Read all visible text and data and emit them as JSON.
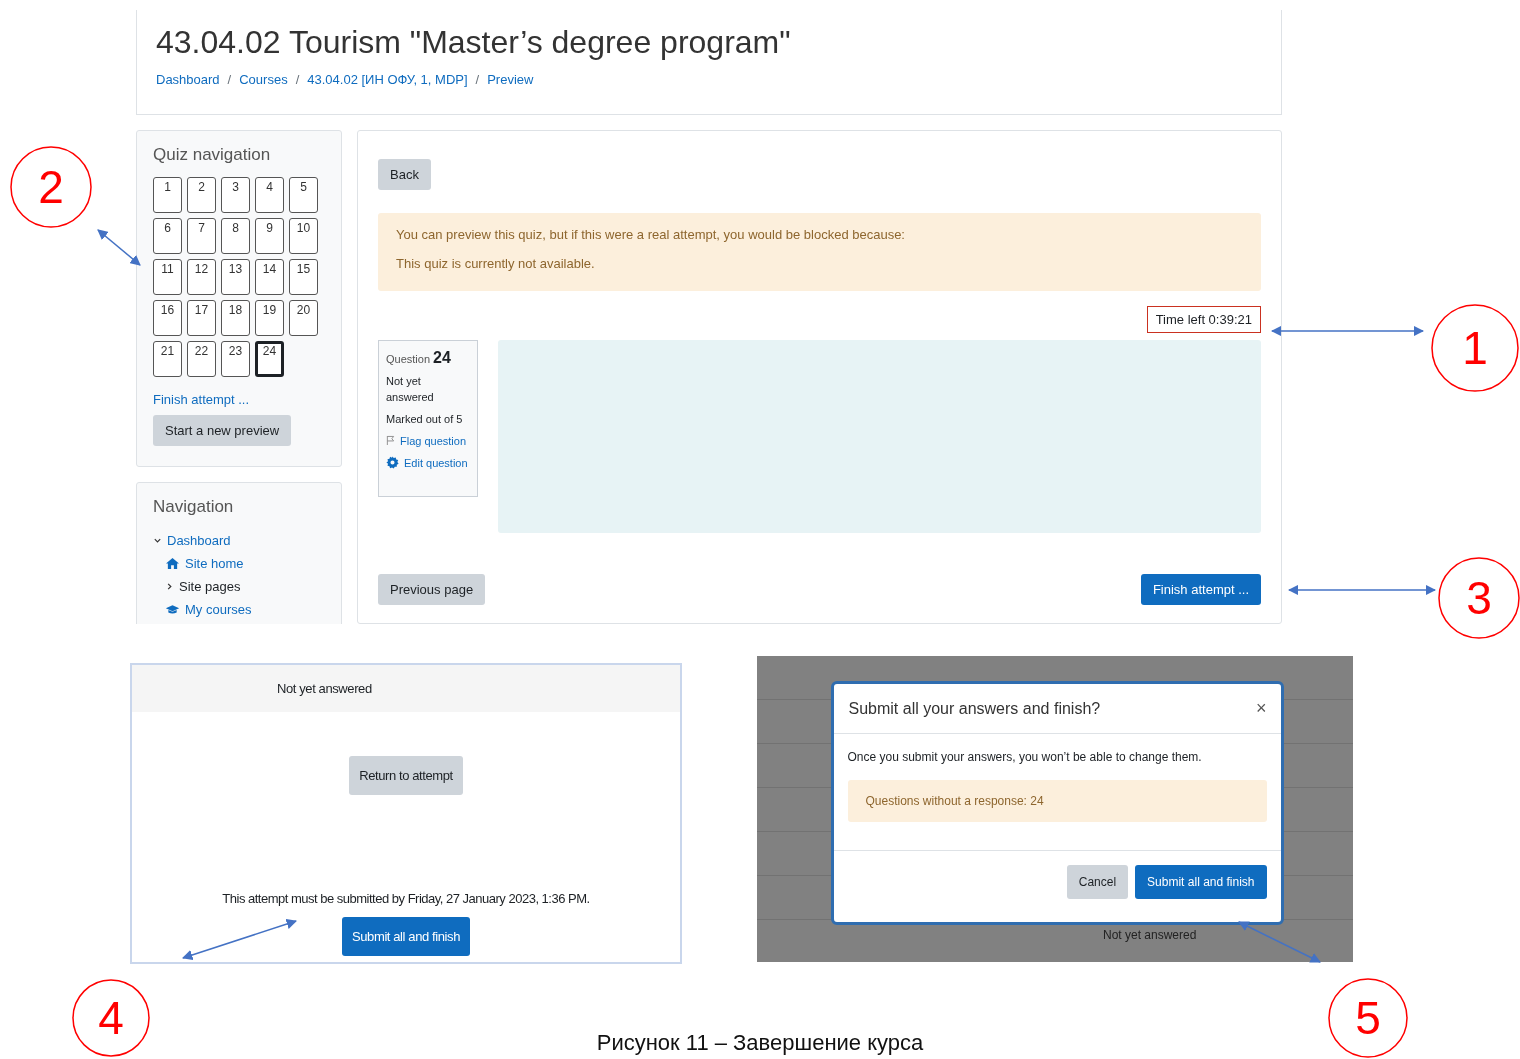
{
  "page_header": {
    "title": "43.04.02 Tourism \"Master’s degree program\"",
    "breadcrumb": [
      "Dashboard",
      "Courses",
      "43.04.02 [ИН ОФУ, 1, MDP]",
      "Preview"
    ],
    "separator": "/"
  },
  "quiz_navigation": {
    "title": "Quiz navigation",
    "questions": [
      {
        "label": "1",
        "selected": false
      },
      {
        "label": "2",
        "selected": false
      },
      {
        "label": "3",
        "selected": false
      },
      {
        "label": "4",
        "selected": false
      },
      {
        "label": "5",
        "selected": false
      },
      {
        "label": "6",
        "selected": false
      },
      {
        "label": "7",
        "selected": false
      },
      {
        "label": "8",
        "selected": false
      },
      {
        "label": "9",
        "selected": false
      },
      {
        "label": "10",
        "selected": false
      },
      {
        "label": "11",
        "selected": false
      },
      {
        "label": "12",
        "selected": false
      },
      {
        "label": "13",
        "selected": false
      },
      {
        "label": "14",
        "selected": false
      },
      {
        "label": "15",
        "selected": false
      },
      {
        "label": "16",
        "selected": false
      },
      {
        "label": "17",
        "selected": false
      },
      {
        "label": "18",
        "selected": false
      },
      {
        "label": "19",
        "selected": false
      },
      {
        "label": "20",
        "selected": false
      },
      {
        "label": "21",
        "selected": false
      },
      {
        "label": "22",
        "selected": false
      },
      {
        "label": "23",
        "selected": false
      },
      {
        "label": "24",
        "selected": true
      }
    ],
    "finish_link": "Finish attempt ...",
    "new_preview_button": "Start a new preview"
  },
  "navigation": {
    "title": "Navigation",
    "items": [
      {
        "label": "Dashboard",
        "kind": "node",
        "expanded": true,
        "children": [
          {
            "label": "Site home",
            "kind": "home"
          },
          {
            "label": "Site pages",
            "kind": "node",
            "expanded": false
          },
          {
            "label": "My courses",
            "kind": "courses"
          }
        ]
      }
    ]
  },
  "quiz": {
    "back_button": "Back",
    "warning": [
      "You can preview this quiz, but if this were a real attempt, you would be blocked because:",
      "This quiz is currently not available."
    ],
    "timer": "Time left 0:39:21",
    "question_info": {
      "label": "Question",
      "number": "24",
      "status": "Not yet answered",
      "mark": "Marked out of 5",
      "flag": "Flag question",
      "edit": "Edit question"
    },
    "previous_button": "Previous page",
    "finish_button": "Finish attempt ..."
  },
  "summary_screenshot": {
    "status": "Not yet answered",
    "return_button": "Return to attempt",
    "deadline": "This attempt must be submitted by Friday, 27 January 2023, 1:36 PM.",
    "submit_button": "Submit all and finish"
  },
  "dialog_screenshot": {
    "title": "Submit all your answers and finish?",
    "close": "×",
    "message": "Once you submit your answers, you won’t be able to change them.",
    "alert": "Questions without a response: 24",
    "cancel_button": "Cancel",
    "submit_button": "Submit all and finish",
    "background_text": "Not yet answered"
  },
  "callouts": [
    {
      "label": "1"
    },
    {
      "label": "2"
    },
    {
      "label": "3"
    },
    {
      "label": "4"
    },
    {
      "label": "5"
    }
  ],
  "caption": "Рисунок 11 – Завершение курса"
}
